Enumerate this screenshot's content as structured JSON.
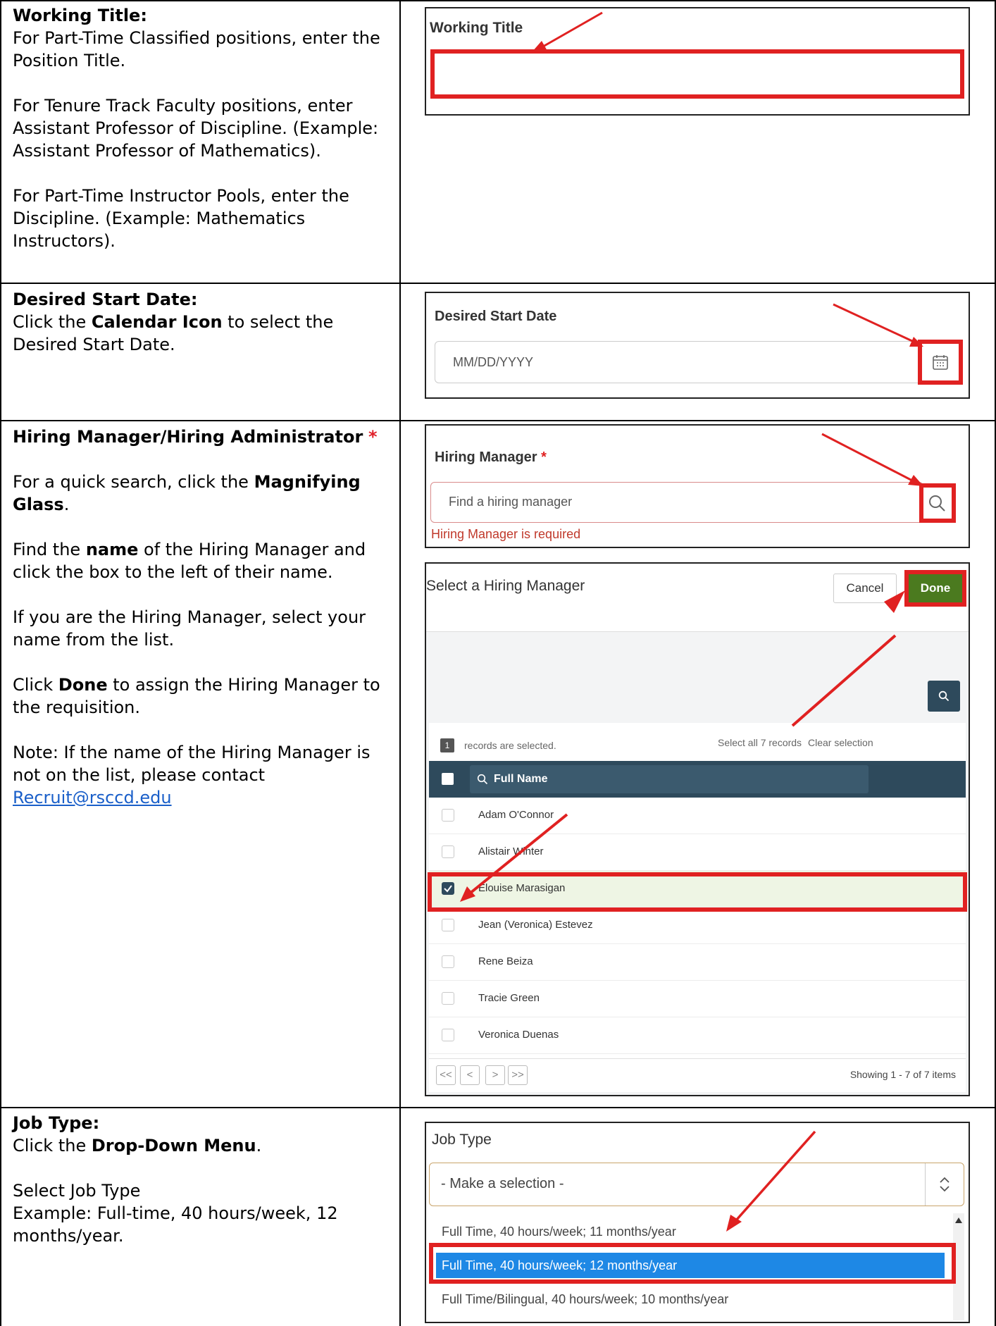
{
  "rows": {
    "working_title": {
      "heading": "Working Title:",
      "para1": "For Part-Time Classified positions, enter the Position Title.",
      "para2": "For Tenure Track Faculty positions, enter Assistant Professor of Discipline. (Example: Assistant Professor of Mathematics).",
      "para3": "For Part-Time Instructor Pools, enter the Discipline. (Example: Mathematics Instructors).",
      "shot": {
        "field_label": "Working Title"
      }
    },
    "start_date": {
      "heading": "Desired Start Date:",
      "text_pre": "Click the ",
      "text_bold": "Calendar Icon",
      "text_post": " to select the Desired Start Date.",
      "shot": {
        "field_label": "Desired Start Date",
        "placeholder": "MM/DD/YYYY",
        "icon": "calendar-icon"
      }
    },
    "hiring_manager": {
      "heading": "Hiring Manager/Hiring Administrator",
      "required_mark": "*",
      "p1_pre": "For a quick search, click the ",
      "p1_bold": "Magnifying Glass",
      "p1_post": ".",
      "p2_pre": "Find the ",
      "p2_bold": "name",
      "p2_post": " of the Hiring Manager and click the box to the left of their name.",
      "p3": "If you are the Hiring Manager, select your name from the list.",
      "p4_pre": "Click ",
      "p4_bold": "Done",
      "p4_post": " to assign the Hiring Manager to the requisition.",
      "p5_pre": "Note: If the name of the Hiring Manager is not on the list, please contact ",
      "p5_link": "Recruit@rsccd.edu",
      "search_shot": {
        "field_label": "Hiring Manager",
        "required_mark": "*",
        "placeholder": "Find a hiring manager",
        "error": "Hiring Manager is required",
        "icon": "magnifying-glass-icon"
      },
      "dialog": {
        "title": "Select a Hiring Manager",
        "cancel": "Cancel",
        "done": "Done",
        "selected_count": "1",
        "selected_text": "records are selected.",
        "select_all": "Select all 7 records",
        "clear": "Clear selection",
        "column_header": "Full Name",
        "names": [
          "Adam O'Connor",
          "Alistair Winter",
          "Elouise Marasigan",
          "Jean (Veronica) Estevez",
          "Rene Beiza",
          "Tracie Green",
          "Veronica Duenas"
        ],
        "checked_index": 2,
        "pager": [
          "<<",
          "<",
          ">",
          ">>"
        ],
        "showing": "Showing 1 - 7 of 7 items",
        "colors": {
          "header": "#2e4a5c",
          "done": "#4b7a1f",
          "selected_row": "#eef5e4"
        }
      }
    },
    "job_type": {
      "heading": "Job Type:",
      "p1_pre": "Click the ",
      "p1_bold": "Drop-Down Menu",
      "p1_post": ".",
      "p2": "Select Job Type",
      "p3": "Example: Full-time, 40 hours/week, 12 months/year.",
      "shot": {
        "field_label": "Job Type",
        "select_value": "- Make a selection -",
        "options": [
          "Full Time, 40 hours/week; 11 months/year",
          "Full Time, 40 hours/week; 12 months/year",
          "Full Time/Bilingual, 40 hours/week; 10 months/year"
        ],
        "highlighted_index": 1,
        "colors": {
          "highlight": "#1e88e5",
          "select_border": "#c9a46a",
          "annotation": "#e02121"
        }
      }
    }
  }
}
